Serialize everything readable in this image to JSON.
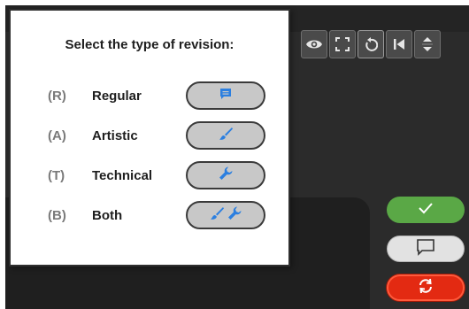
{
  "dialog": {
    "title": "Select the type of revision:",
    "options": [
      {
        "code": "(R)",
        "label": "Regular",
        "icon": "comment-icon"
      },
      {
        "code": "(A)",
        "label": "Artistic",
        "icon": "brush-icon"
      },
      {
        "code": "(T)",
        "label": "Technical",
        "icon": "wrench-icon"
      },
      {
        "code": "(B)",
        "label": "Both",
        "icon": "brush-wrench-icon"
      }
    ]
  },
  "toolbar": {
    "buttons": [
      "eye-icon",
      "fullscreen-icon",
      "reset-icon",
      "skip-back-icon",
      "stepper-icon"
    ]
  },
  "actions": {
    "buttons": [
      "check-icon",
      "comment-icon",
      "reload-icon"
    ]
  },
  "colors": {
    "accent_blue": "#2b7fe0",
    "ok_green": "#5aa846",
    "reload_red": "#e32a12",
    "app_bg": "#2b2b2b"
  }
}
